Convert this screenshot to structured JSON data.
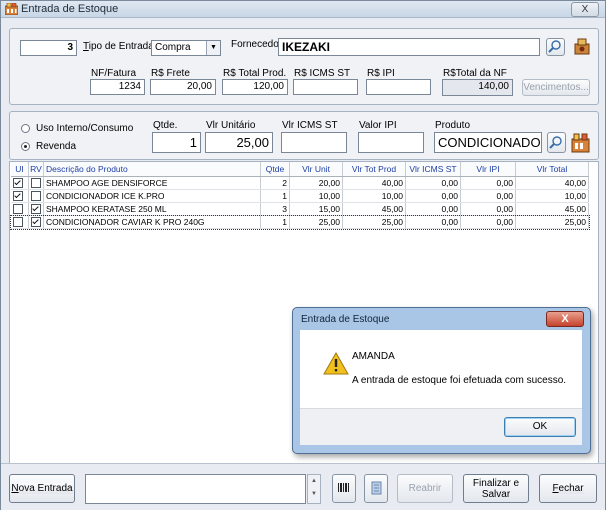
{
  "window": {
    "title": "Entrada de Estoque",
    "close_label": "X"
  },
  "header": {
    "number": "3",
    "tipo_entrada_label": "Tipo de Entrada",
    "tipo_entrada_value": "Compra",
    "fornecedor_label": "Fornecedor",
    "fornecedor_value": "IKEZAKI",
    "nf_label": "NF/Fatura",
    "nf_value": "1234",
    "frete_label": "R$ Frete",
    "frete_value": "20,00",
    "total_prod_label": "R$ Total Prod.",
    "total_prod_value": "120,00",
    "icms_st_label": "R$ ICMS ST",
    "icms_st_value": "",
    "ipi_label": "R$ IPI",
    "ipi_value": "",
    "total_nf_label": "R$Total da NF",
    "total_nf_value": "140,00",
    "vencimentos_label": "Vencimentos..."
  },
  "entry": {
    "uso_interno_label": "Uso Interno/Consumo",
    "revenda_label": "Revenda",
    "qtde_label": "Qtde.",
    "qtde_value": "1",
    "vlr_unit_label": "Vlr Unitário",
    "vlr_unit_value": "25,00",
    "vlr_icms_st_label": "Vlr ICMS ST",
    "vlr_icms_st_value": "",
    "valor_ipi_label": "Valor IPI",
    "valor_ipi_value": "",
    "produto_label": "Produto",
    "produto_value": "CONDICIONADOR"
  },
  "grid": {
    "columns": [
      "UI",
      "RV",
      "Descrição do Produto",
      "Qtde",
      "Vlr Unit",
      "Vlr Tot Prod",
      "Vlr ICMS ST",
      "Vlr IPI",
      "Vlr Total"
    ],
    "rows": [
      {
        "ui": true,
        "rv": false,
        "desc": "SHAMPOO AGE DENSIFORCE",
        "qtde": "2",
        "unit": "20,00",
        "tot": "40,00",
        "icms": "0,00",
        "ipi": "0,00",
        "total": "40,00"
      },
      {
        "ui": true,
        "rv": false,
        "desc": "CONDICIONADOR ICE K.PRO",
        "qtde": "1",
        "unit": "10,00",
        "tot": "10,00",
        "icms": "0,00",
        "ipi": "0,00",
        "total": "10,00"
      },
      {
        "ui": false,
        "rv": true,
        "desc": "SHAMPOO KERATASE 250 ML",
        "qtde": "3",
        "unit": "15,00",
        "tot": "45,00",
        "icms": "0,00",
        "ipi": "0,00",
        "total": "45,00"
      },
      {
        "ui": false,
        "rv": true,
        "desc": "CONDICIONADOR CAVIAR K PRO 240G",
        "qtde": "1",
        "unit": "25,00",
        "tot": "25,00",
        "icms": "0,00",
        "ipi": "0,00",
        "total": "25,00"
      }
    ]
  },
  "dialog": {
    "title": "Entrada de Estoque",
    "close_label": "X",
    "heading": "AMANDA",
    "message": "A entrada de estoque foi efetuada com sucesso.",
    "ok_label": "OK"
  },
  "footer": {
    "nova_entrada_label": "Nova Entrada",
    "reabrir_label": "Reabrir",
    "finalizar_line1": "Finalizar e",
    "finalizar_line2": "Salvar",
    "fechar_label": "Fechar"
  },
  "colors": {
    "header_text": "#1d3fa8",
    "dialog_frame": "#a9c6e6",
    "warning": "#f2c01e"
  }
}
